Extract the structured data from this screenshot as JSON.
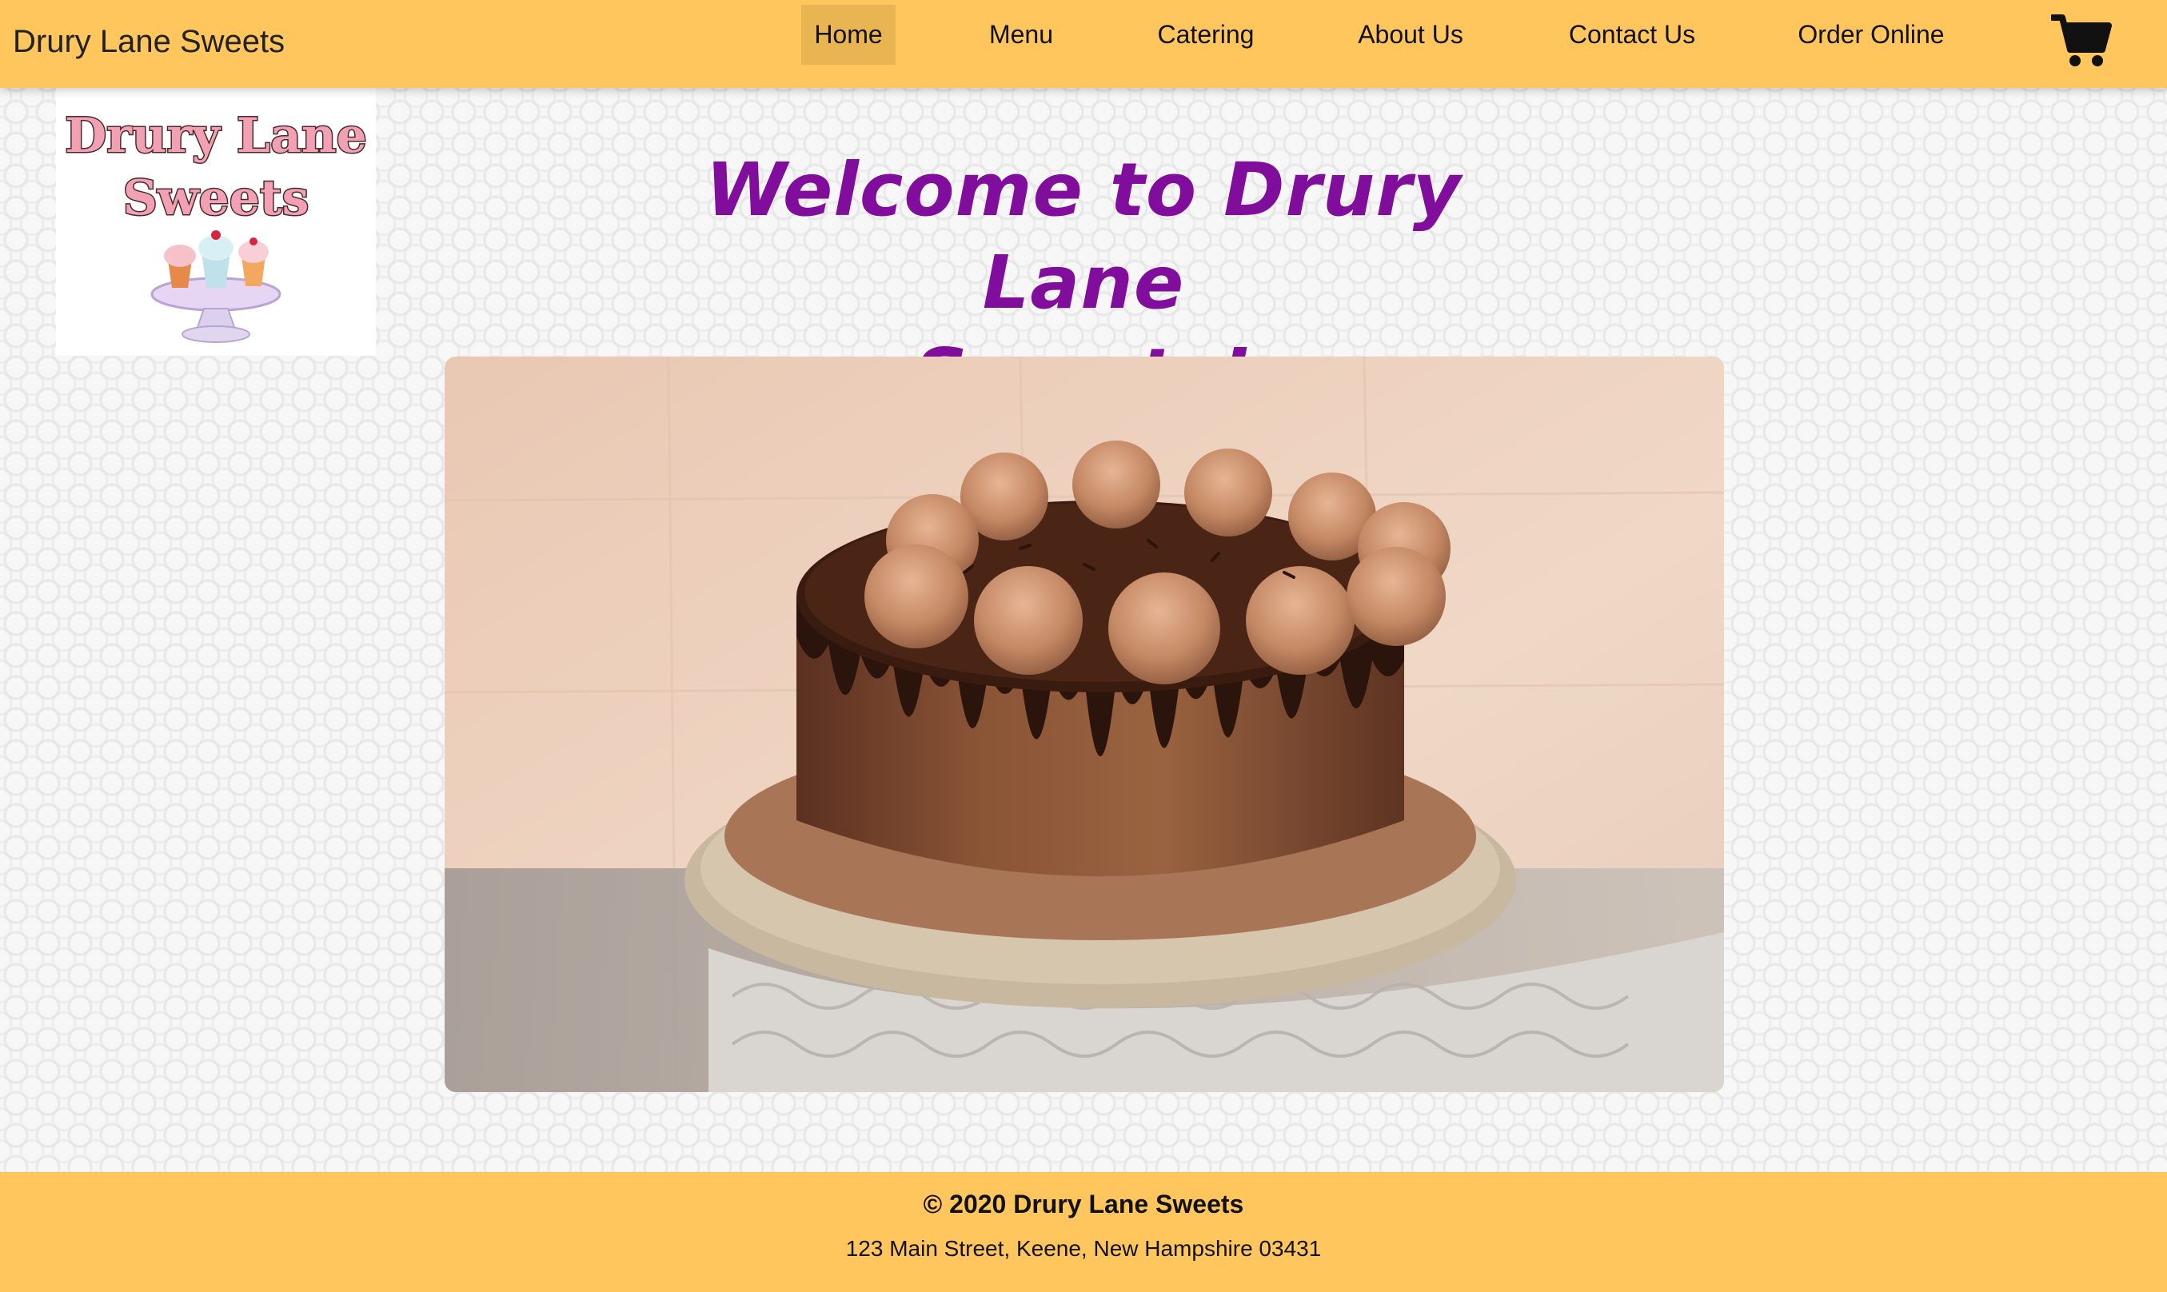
{
  "header": {
    "brand": "Drury Lane Sweets",
    "nav": [
      {
        "label": "Home",
        "active": true
      },
      {
        "label": "Menu",
        "active": false
      },
      {
        "label": "Catering",
        "active": false
      },
      {
        "label": "About Us",
        "active": false
      },
      {
        "label": "Contact Us",
        "active": false
      },
      {
        "label": "Order Online",
        "active": false
      }
    ],
    "cart_icon": "shopping-cart-icon"
  },
  "logo": {
    "line1": "Drury Lane",
    "line2": "Sweets"
  },
  "main": {
    "welcome_line1": "Welcome to Drury Lane",
    "welcome_line2": "Sweets!",
    "hero_image": "chocolate-drip-cake-photo"
  },
  "footer": {
    "copyright": "© 2020 Drury Lane Sweets",
    "address": "123 Main Street, Keene, New Hampshire 03431"
  },
  "colors": {
    "header_bg": "#ffc65e",
    "active_nav_bg": "#e9b552",
    "title": "#800d9b",
    "logo_text": "#f2a0b3"
  }
}
